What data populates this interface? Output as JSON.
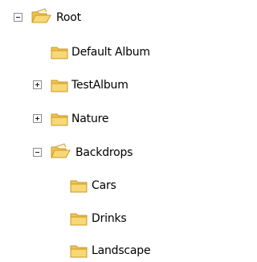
{
  "tree": {
    "root": {
      "label": "Root",
      "state": "expanded",
      "children": [
        {
          "label": "Default Album",
          "state": "leaf"
        },
        {
          "label": "TestAlbum",
          "state": "collapsed"
        },
        {
          "label": "Nature",
          "state": "collapsed"
        },
        {
          "label": "Backdrops",
          "state": "expanded",
          "children": [
            {
              "label": "Cars",
              "state": "leaf"
            },
            {
              "label": "Drinks",
              "state": "leaf"
            },
            {
              "label": "Landscape",
              "state": "leaf"
            }
          ]
        }
      ]
    }
  },
  "icons": {
    "expanded_toggle": "minus-box-icon",
    "collapsed_toggle": "plus-box-icon",
    "folder_open": "folder-open-icon",
    "folder_closed": "folder-closed-icon"
  },
  "colors": {
    "folder_fill": "#f6d36c",
    "folder_edge": "#caa23a",
    "toggle_border": "#8c8c8c"
  }
}
